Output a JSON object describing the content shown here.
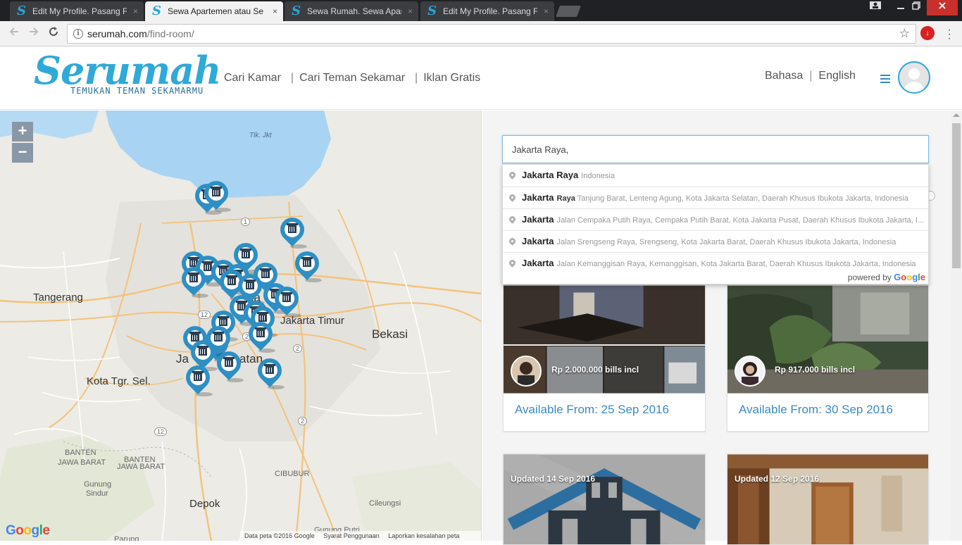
{
  "browser": {
    "tabs": [
      {
        "title": "Edit My Profile. Pasang F",
        "active": false
      },
      {
        "title": "Sewa Apartemen atau Se",
        "active": true
      },
      {
        "title": "Sewa Rumah. Sewa Apar",
        "active": false
      },
      {
        "title": "Edit My Profile. Pasang F",
        "active": false
      }
    ],
    "tab_close": "×",
    "favicon": "S",
    "url_host": "serumah.com",
    "url_path": "/find-room/"
  },
  "header": {
    "logo_word": "Serumah",
    "logo_tagline": "TEMUKAN TEMAN SEKAMARMU",
    "nav": [
      "Cari Kamar",
      "Cari Teman Sekamar",
      "Iklan Gratis"
    ],
    "nav_sep": "|",
    "lang_label": "Bahasa",
    "lang_value": "English"
  },
  "map": {
    "zoom_in": "+",
    "zoom_out": "−",
    "labels": {
      "bay": "Tlk. Jkt",
      "tangerang": "Tangerang",
      "jakarta_timur": "Jakarta Timur",
      "bekasi": "Bekasi",
      "kota_tgr_sel": "Kota Tgr. Sel.",
      "banten": "BANTEN",
      "jawa_barat_1": "JAWA BARAT",
      "banten_2": "BANTEN",
      "jawa_barat_2": "JAWA BARAT",
      "cibubur": "CIBUBUR",
      "gunung_sindur_1": "Gunung",
      "gunung_sindur_2": "Sindur",
      "depok": "Depok",
      "cileungsi": "Cileungsi",
      "gunung_putri": "Gunung Putri",
      "parung": "Parung",
      "jakarta_selatan_fragment_1": "Ja",
      "jakarta_selatan_fragment_2": "atan",
      "jakarta_fragment": "ka"
    },
    "road_numbers": [
      "1",
      "1",
      "12",
      "2",
      "2",
      "2",
      "12"
    ],
    "google": "Google",
    "footer": [
      "Data peta ©2016 Google",
      "Syarat Penggunaan",
      "Laporkan kesalahan peta"
    ],
    "accent": "#2d8fc4"
  },
  "search": {
    "value": "Jakarta Raya,",
    "suggestions": [
      {
        "main": "Jakarta Raya",
        "secondary": "Indonesia",
        "mid": ""
      },
      {
        "main": "Jakarta",
        "mid": "Raya",
        "secondary": "Tanjung Barat, Lenteng Agung, Kota Jakarta Selatan, Daerah Khusus Ibukota Jakarta, Indonesia"
      },
      {
        "main": "Jakarta",
        "mid": "Jalan Cempaka Putih Raya,",
        "secondary": "Cempaka Putih Barat, Kota Jakarta Pusat, Daerah Khusus Ibukota Jakarta, I..."
      },
      {
        "main": "Jakarta",
        "mid": "Jalan Srengseng Raya,",
        "secondary": "Srengseng, Kota Jakarta Barat, Daerah Khusus Ibukota Jakarta, Indonesia"
      },
      {
        "main": "Jakarta",
        "mid": "Jalan Kemanggisan Raya,",
        "secondary": "Kemanggisan, Kota Jakarta Barat, Daerah Khusus Ibukota Jakarta, Indonesia"
      }
    ],
    "powered_by": "powered by",
    "powered_brand": "Google"
  },
  "listings": [
    {
      "price": "Rp 2.000.000 bills incl",
      "available": "Available From: 25 Sep 2016"
    },
    {
      "price": "Rp 917.000 bills incl",
      "available": "Available From: 30 Sep 2016"
    },
    {
      "updated": "Updated 14 Sep 2016"
    },
    {
      "updated": "Updated 12 Sep 2016"
    }
  ]
}
